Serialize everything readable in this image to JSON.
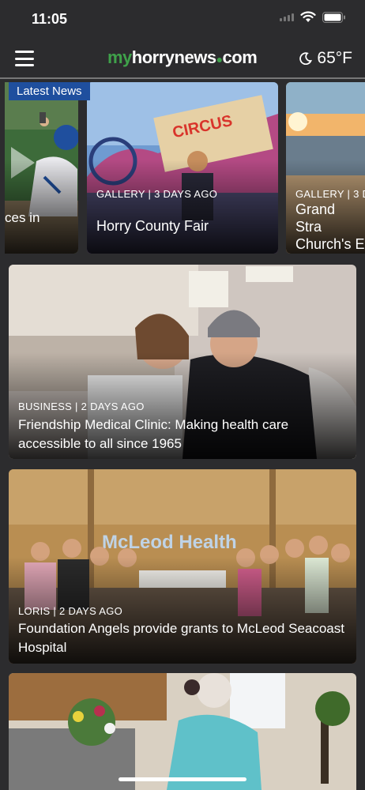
{
  "status": {
    "time": "11:05"
  },
  "header": {
    "logo_my": "my",
    "logo_mid": "horrynews",
    "logo_dot": "●",
    "logo_com": "com",
    "weather_temp": "65°F"
  },
  "carousel": {
    "badge": "Latest News",
    "items": [
      {
        "meta": "",
        "headline": "ces in"
      },
      {
        "meta": "GALLERY | 3 DAYS AGO",
        "headline": "Horry County Fair"
      },
      {
        "meta": "GALLERY | 3 D",
        "headline": "Grand Stra Church's E Service at"
      }
    ]
  },
  "stories": [
    {
      "meta": "BUSINESS | 2 DAYS AGO",
      "headline": "Friendship Medical Clinic: Making health care accessible to all since 1965"
    },
    {
      "meta": "LORIS | 2 DAYS AGO",
      "headline": "Foundation Angels provide grants to McLeod Seacoast Hospital"
    },
    {
      "meta": "",
      "headline": ""
    }
  ],
  "photo_signs": {
    "mcleod": "McLeod Health",
    "circus": "CIRCUS"
  },
  "colors": {
    "accent_green": "#3fa14a",
    "badge_blue": "#1f4f9e",
    "background": "#2c2c2e"
  }
}
